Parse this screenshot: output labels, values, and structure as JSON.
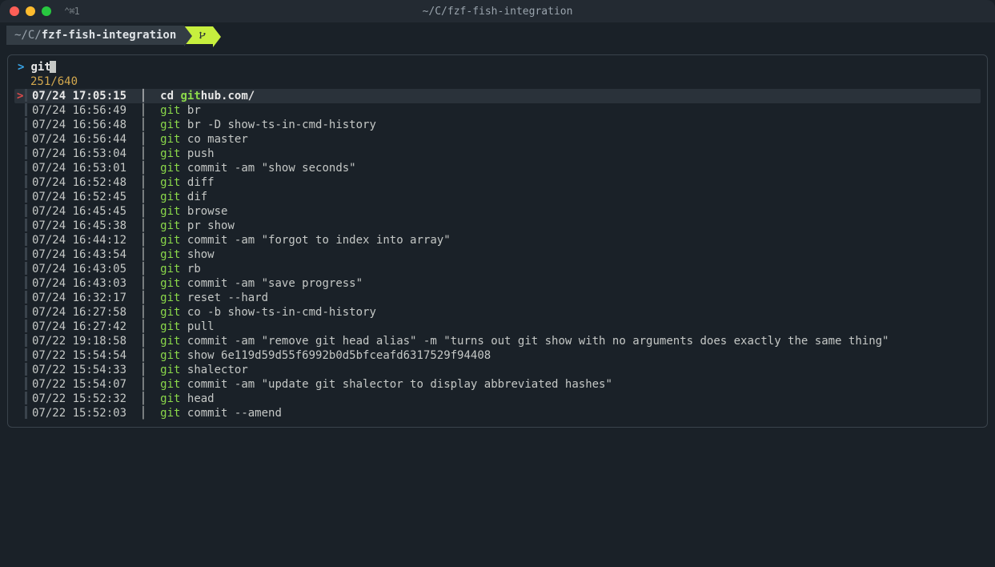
{
  "title": {
    "icon_text": "⌃⌘1",
    "path": "~/C/fzf-fish-integration"
  },
  "breadcrumb": {
    "seg1_prefix": "~/C/",
    "seg1_main": "fzf-fish-integration"
  },
  "fzf": {
    "prompt": ">",
    "query": "git",
    "count": "251/640",
    "selected_marker": ">",
    "rows": [
      {
        "ts": "07/24 17:05:15",
        "pre": "cd ",
        "match": "git",
        "rest": "hub.com/",
        "sel": true
      },
      {
        "ts": "07/24 16:56:49",
        "pre": "",
        "match": "git",
        "rest": " br"
      },
      {
        "ts": "07/24 16:56:48",
        "pre": "",
        "match": "git",
        "rest": " br -D show-ts-in-cmd-history"
      },
      {
        "ts": "07/24 16:56:44",
        "pre": "",
        "match": "git",
        "rest": " co master"
      },
      {
        "ts": "07/24 16:53:04",
        "pre": "",
        "match": "git",
        "rest": " push"
      },
      {
        "ts": "07/24 16:53:01",
        "pre": "",
        "match": "git",
        "rest": " commit -am \"show seconds\""
      },
      {
        "ts": "07/24 16:52:48",
        "pre": "",
        "match": "git",
        "rest": " diff"
      },
      {
        "ts": "07/24 16:52:45",
        "pre": "",
        "match": "git",
        "rest": " dif"
      },
      {
        "ts": "07/24 16:45:45",
        "pre": "",
        "match": "git",
        "rest": " browse"
      },
      {
        "ts": "07/24 16:45:38",
        "pre": "",
        "match": "git",
        "rest": " pr show"
      },
      {
        "ts": "07/24 16:44:12",
        "pre": "",
        "match": "git",
        "rest": " commit -am \"forgot to index into array\""
      },
      {
        "ts": "07/24 16:43:54",
        "pre": "",
        "match": "git",
        "rest": " show"
      },
      {
        "ts": "07/24 16:43:05",
        "pre": "",
        "match": "git",
        "rest": " rb"
      },
      {
        "ts": "07/24 16:43:03",
        "pre": "",
        "match": "git",
        "rest": " commit -am \"save progress\""
      },
      {
        "ts": "07/24 16:32:17",
        "pre": "",
        "match": "git",
        "rest": " reset --hard"
      },
      {
        "ts": "07/24 16:27:58",
        "pre": "",
        "match": "git",
        "rest": " co -b show-ts-in-cmd-history"
      },
      {
        "ts": "07/24 16:27:42",
        "pre": "",
        "match": "git",
        "rest": " pull"
      },
      {
        "ts": "07/22 19:18:58",
        "pre": "",
        "match": "git",
        "rest": " commit -am \"remove git head alias\" -m \"turns out git show with no arguments does exactly the same thing\""
      },
      {
        "ts": "07/22 15:54:54",
        "pre": "",
        "match": "git",
        "rest": " show 6e119d59d55f6992b0d5bfceafd6317529f94408"
      },
      {
        "ts": "07/22 15:54:33",
        "pre": "",
        "match": "git",
        "rest": " shalector"
      },
      {
        "ts": "07/22 15:54:07",
        "pre": "",
        "match": "git",
        "rest": " commit -am \"update git shalector to display abbreviated hashes\""
      },
      {
        "ts": "07/22 15:52:32",
        "pre": "",
        "match": "git",
        "rest": " head"
      },
      {
        "ts": "07/22 15:52:03",
        "pre": "",
        "match": "git",
        "rest": " commit --amend"
      }
    ]
  }
}
